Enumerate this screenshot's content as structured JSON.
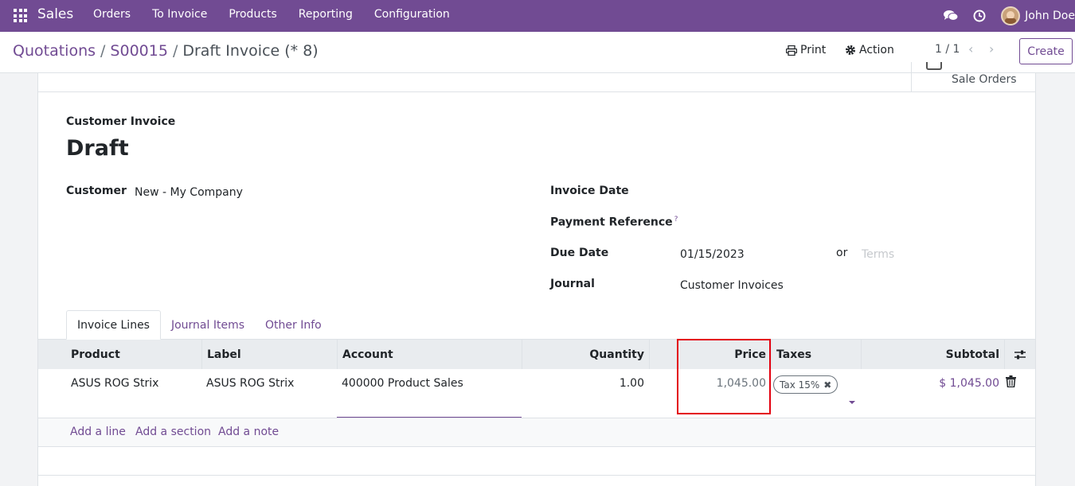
{
  "navbar": {
    "app_name": "Sales",
    "menu": [
      "Orders",
      "To Invoice",
      "Products",
      "Reporting",
      "Configuration"
    ],
    "user_name": "John Doe"
  },
  "control": {
    "breadcrumb": [
      "Quotations",
      "S00015",
      "Draft Invoice (* 8)"
    ],
    "print_label": "Print",
    "action_label": "Action",
    "pager": "1 / 1",
    "create_label": "Create"
  },
  "smart_button": {
    "label": "Sale Orders"
  },
  "invoice": {
    "doc_type": "Customer Invoice",
    "status": "Draft",
    "customer_label": "Customer",
    "customer_value": "New - My Company",
    "invoice_date_label": "Invoice Date",
    "payment_reference_label": "Payment Reference",
    "payment_reference_help": "?",
    "due_date_label": "Due Date",
    "due_date_value": "01/15/2023",
    "or_label": "or",
    "terms_placeholder": "Terms",
    "journal_label": "Journal",
    "journal_value": "Customer Invoices"
  },
  "tabs": [
    "Invoice Lines",
    "Journal Items",
    "Other Info"
  ],
  "lines": {
    "headers": {
      "product": "Product",
      "label": "Label",
      "account": "Account",
      "quantity": "Quantity",
      "price": "Price",
      "taxes": "Taxes",
      "subtotal": "Subtotal"
    },
    "rows": [
      {
        "product": "ASUS ROG Strix",
        "label": "ASUS ROG Strix",
        "account": "400000 Product Sales",
        "quantity": "1.00",
        "price": "1,045.00",
        "tax": "Tax 15%",
        "subtotal": "$ 1,045.00"
      }
    ],
    "add_links": [
      "Add a line",
      "Add a section",
      "Add a note"
    ]
  },
  "colors": {
    "brand": "#714b93",
    "highlight": "#e3000f"
  }
}
